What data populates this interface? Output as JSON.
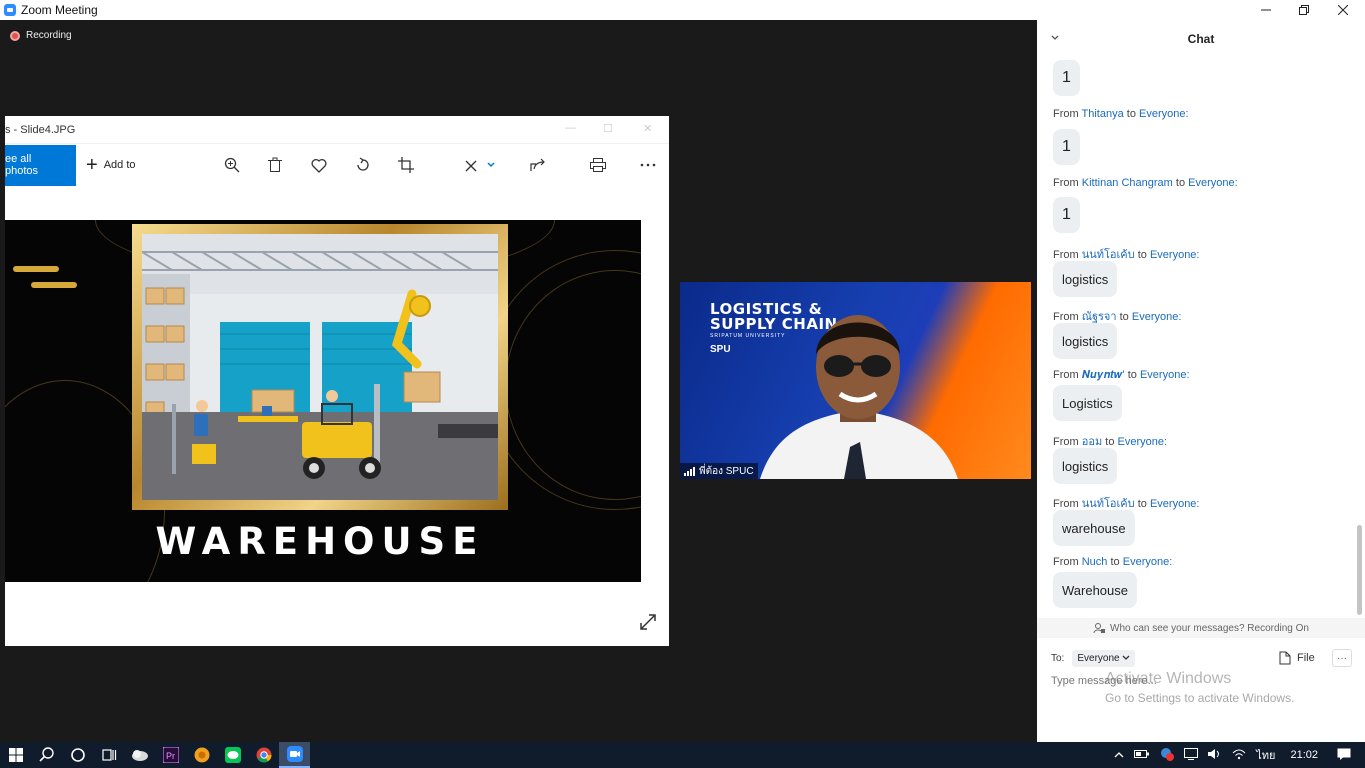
{
  "window": {
    "title": "Zoom Meeting"
  },
  "recording": {
    "label": "Recording"
  },
  "photos": {
    "title": "s - Slide4.JPG",
    "see_all": "ee all photos",
    "add_to": "Add to",
    "slide_text": "WAREHOUSE"
  },
  "video": {
    "brand_line1": "LOGISTICS &",
    "brand_line2": "SUPPLY CHAIN",
    "brand_sub": "SRIPATUM UNIVERSITY",
    "brand_logo": "SPU",
    "participant_name": "พี่ต้อง SPUC"
  },
  "chat": {
    "title": "Chat",
    "first_message": "1",
    "messages": [
      {
        "from": "Thitanya",
        "to": "Everyone:",
        "text": "1"
      },
      {
        "from": "Kittinan Changram",
        "to": "Everyone:",
        "text": "1"
      },
      {
        "from": "นนท์โอเค้บ",
        "to": "Everyone:",
        "text": "logistics"
      },
      {
        "from": "ณัฐรจา",
        "to": "Everyone:",
        "text": "logistics"
      },
      {
        "from": "𝑵𝒖𝒚𝒏𝒕𝒘'",
        "to": "Everyone:",
        "text": "Logistics"
      },
      {
        "from": "ออม",
        "to": "Everyone:",
        "text": "logistics"
      },
      {
        "from": "นนท์โอเค้บ",
        "to": "Everyone:",
        "text": "warehouse"
      },
      {
        "from": "Nuch",
        "to": "Everyone:",
        "text": "Warehouse"
      }
    ],
    "from_word": "From",
    "to_word": "to",
    "who_can_see": "Who can see your messages? Recording On",
    "to_label": "To:",
    "to_value": "Everyone",
    "file_label": "File",
    "input_placeholder": "Type message here...",
    "activate_title": "Activate Windows",
    "activate_sub": "Go to Settings to activate Windows."
  },
  "taskbar": {
    "language": "ไทย",
    "time": "21:02"
  },
  "colors": {
    "zoom_blue": "#2d8cff",
    "photos_blue": "#0078d7",
    "name_link": "#1a6bbd"
  }
}
